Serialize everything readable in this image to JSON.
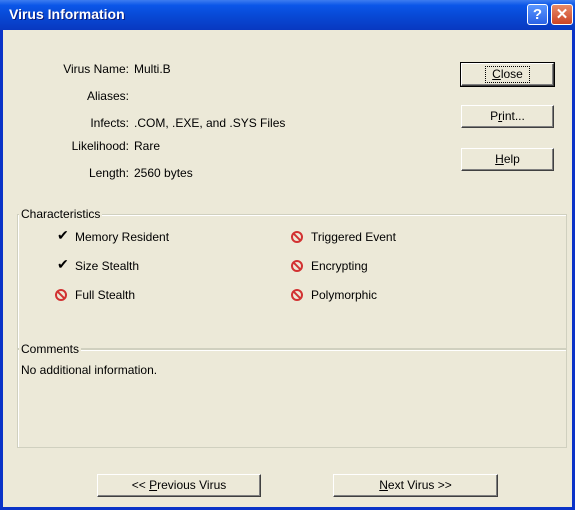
{
  "window": {
    "title": "Virus Information",
    "help_button": "?",
    "close_button": "✕"
  },
  "info": {
    "virus_name_label": "Virus Name:",
    "virus_name_value": "Multi.B",
    "aliases_label": "Aliases:",
    "aliases_value": "",
    "infects_label": "Infects:",
    "infects_value": ".COM, .EXE, and .SYS Files",
    "likelihood_label": "Likelihood:",
    "likelihood_value": "Rare",
    "length_label": "Length:",
    "length_value": "2560 bytes"
  },
  "buttons": {
    "close": {
      "pre": "",
      "ul": "C",
      "post": "lose"
    },
    "print": {
      "pre": "P",
      "ul": "r",
      "post": "int..."
    },
    "help": {
      "pre": "",
      "ul": "H",
      "post": "elp"
    },
    "previous": {
      "pre": "<< ",
      "ul": "P",
      "post": "revious Virus"
    },
    "next": {
      "pre": "",
      "ul": "N",
      "post": "ext Virus >>"
    }
  },
  "characteristics": {
    "legend": "Characteristics",
    "items": [
      {
        "label": "Memory Resident",
        "state": "yes"
      },
      {
        "label": "Size Stealth",
        "state": "yes"
      },
      {
        "label": "Full Stealth",
        "state": "no"
      },
      {
        "label": "Triggered Event",
        "state": "no"
      },
      {
        "label": "Encrypting",
        "state": "no"
      },
      {
        "label": "Polymorphic",
        "state": "no"
      }
    ]
  },
  "comments": {
    "legend": "Comments",
    "text": "No additional information."
  },
  "colors": {
    "titlebar": "#0a56e8",
    "dialog_bg": "#ece9d8",
    "no_icon": "#d23232"
  }
}
